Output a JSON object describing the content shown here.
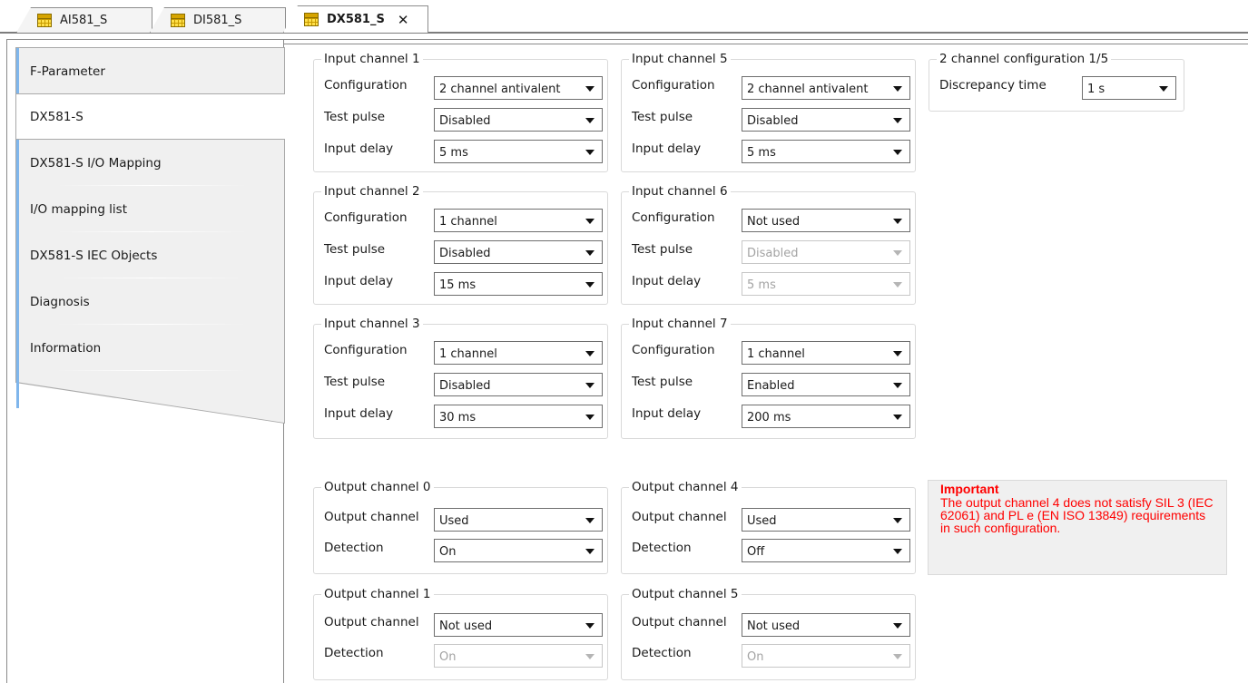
{
  "tabs": [
    {
      "label": "AI581_S"
    },
    {
      "label": "DI581_S"
    },
    {
      "label": "DX581_S",
      "close": "✕"
    }
  ],
  "sidebar": {
    "items": [
      {
        "label": "F-Parameter"
      },
      {
        "label": "DX581-S"
      },
      {
        "label": "DX581-S I/O Mapping"
      },
      {
        "label": "I/O mapping list"
      },
      {
        "label": "DX581-S IEC Objects"
      },
      {
        "label": "Diagnosis"
      },
      {
        "label": "Information"
      }
    ],
    "selected": "DX581-S"
  },
  "labels": {
    "configuration": "Configuration",
    "test_pulse": "Test pulse",
    "input_delay": "Input delay",
    "output_channel": "Output channel",
    "detection": "Detection",
    "discrepancy_time": "Discrepancy time"
  },
  "input_channels": [
    {
      "title": "Input channel 1",
      "configuration": "2 channel antivalent",
      "test_pulse": "Disabled",
      "input_delay": "5 ms"
    },
    {
      "title": "Input channel 2",
      "configuration": "1 channel",
      "test_pulse": "Disabled",
      "input_delay": "15 ms"
    },
    {
      "title": "Input channel 3",
      "configuration": "1 channel",
      "test_pulse": "Disabled",
      "input_delay": "30 ms"
    },
    {
      "title": "Input channel 5",
      "configuration": "2 channel antivalent",
      "test_pulse": "Disabled",
      "input_delay": "5 ms"
    },
    {
      "title": "Input channel 6",
      "configuration": "Not used",
      "test_pulse": "Disabled",
      "input_delay": "5 ms"
    },
    {
      "title": "Input channel 7",
      "configuration": "1 channel",
      "test_pulse": "Enabled",
      "input_delay": "200 ms"
    }
  ],
  "two_channel_config": {
    "title": "2 channel configuration 1/5",
    "discrepancy_time": "1 s"
  },
  "output_channels": [
    {
      "title": "Output channel 0",
      "output_channel": "Used",
      "detection": "On"
    },
    {
      "title": "Output channel 1",
      "output_channel": "Not used",
      "detection": "On"
    },
    {
      "title": "Output channel 4",
      "output_channel": "Used",
      "detection": "Off"
    },
    {
      "title": "Output channel 5",
      "output_channel": "Not used",
      "detection": "On"
    }
  ],
  "important": {
    "title": "Important",
    "message": "The output channel 4 does not satisfy SIL 3 (IEC 62061) and PL e (EN ISO 13849) requirements in such configuration."
  },
  "colors": {
    "accent": "#7fb6ec",
    "warning_text": "#ff0000",
    "panel_bg": "#f0f0f0"
  }
}
